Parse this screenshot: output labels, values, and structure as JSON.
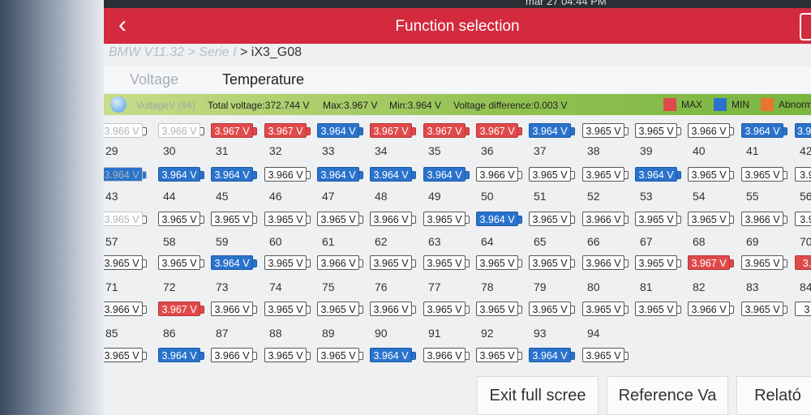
{
  "status_bar": {
    "time": "mar 27 04:44 PM"
  },
  "header": {
    "title": "Function selection",
    "back_glyph": "‹"
  },
  "breadcrumb": {
    "prefix": "BMW V11.32 > Serie I",
    "current": " > iX3_G08"
  },
  "tabs": [
    {
      "label": "Voltage"
    },
    {
      "label": "Temperature"
    }
  ],
  "summary": {
    "voltage_label": "VoltageV (94)",
    "total_voltage": "Total voltage:372.744 V",
    "max": "Max:3.967 V",
    "min": "Min:3.964 V",
    "voltage_difference": "Voltage difference:0.003 V"
  },
  "legend": [
    {
      "label": "MAX",
      "color": "#e04a4a"
    },
    {
      "label": "MIN",
      "color": "#2a73cc"
    },
    {
      "label": "Abnorm",
      "color": "#e8762e"
    }
  ],
  "cells": [
    {
      "n": "",
      "v": "3.966 V",
      "s": "normal"
    },
    {
      "n": "",
      "v": "3.966 V",
      "s": "normal"
    },
    {
      "n": "",
      "v": "3.967 V",
      "s": "max"
    },
    {
      "n": "",
      "v": "3.967 V",
      "s": "max"
    },
    {
      "n": "",
      "v": "3.964 V",
      "s": "min"
    },
    {
      "n": "",
      "v": "3.967 V",
      "s": "max"
    },
    {
      "n": "",
      "v": "3.967 V",
      "s": "max"
    },
    {
      "n": "",
      "v": "3.967 V",
      "s": "max"
    },
    {
      "n": "",
      "v": "3.964 V",
      "s": "min"
    },
    {
      "n": "",
      "v": "3.965 V",
      "s": "normal"
    },
    {
      "n": "",
      "v": "3.965 V",
      "s": "normal"
    },
    {
      "n": "",
      "v": "3.966 V",
      "s": "normal"
    },
    {
      "n": "",
      "v": "3.964 V",
      "s": "min"
    },
    {
      "n": "",
      "v": "3.96",
      "s": "min"
    },
    {
      "n": "29",
      "v": "3.964 V",
      "s": "min"
    },
    {
      "n": "30",
      "v": "3.964 V",
      "s": "min"
    },
    {
      "n": "31",
      "v": "3.964 V",
      "s": "min"
    },
    {
      "n": "32",
      "v": "3.966 V",
      "s": "normal"
    },
    {
      "n": "33",
      "v": "3.964 V",
      "s": "min"
    },
    {
      "n": "34",
      "v": "3.964 V",
      "s": "min"
    },
    {
      "n": "35",
      "v": "3.964 V",
      "s": "min"
    },
    {
      "n": "36",
      "v": "3.966 V",
      "s": "normal"
    },
    {
      "n": "37",
      "v": "3.965 V",
      "s": "normal"
    },
    {
      "n": "38",
      "v": "3.965 V",
      "s": "normal"
    },
    {
      "n": "39",
      "v": "3.964 V",
      "s": "min"
    },
    {
      "n": "40",
      "v": "3.965 V",
      "s": "normal"
    },
    {
      "n": "41",
      "v": "3.965 V",
      "s": "normal"
    },
    {
      "n": "42",
      "v": "3.9",
      "s": "normal"
    },
    {
      "n": "43",
      "v": "3.965 V",
      "s": "normal"
    },
    {
      "n": "44",
      "v": "3.965 V",
      "s": "normal"
    },
    {
      "n": "45",
      "v": "3.965 V",
      "s": "normal"
    },
    {
      "n": "46",
      "v": "3.965 V",
      "s": "normal"
    },
    {
      "n": "47",
      "v": "3.965 V",
      "s": "normal"
    },
    {
      "n": "48",
      "v": "3.966 V",
      "s": "normal"
    },
    {
      "n": "49",
      "v": "3.965 V",
      "s": "normal"
    },
    {
      "n": "50",
      "v": "3.964 V",
      "s": "min"
    },
    {
      "n": "51",
      "v": "3.965 V",
      "s": "normal"
    },
    {
      "n": "52",
      "v": "3.966 V",
      "s": "normal"
    },
    {
      "n": "53",
      "v": "3.965 V",
      "s": "normal"
    },
    {
      "n": "54",
      "v": "3.965 V",
      "s": "normal"
    },
    {
      "n": "55",
      "v": "3.966 V",
      "s": "normal"
    },
    {
      "n": "56",
      "v": "3.9",
      "s": "normal"
    },
    {
      "n": "57",
      "v": "3.965 V",
      "s": "normal"
    },
    {
      "n": "58",
      "v": "3.965 V",
      "s": "normal"
    },
    {
      "n": "59",
      "v": "3.964 V",
      "s": "min"
    },
    {
      "n": "60",
      "v": "3.965 V",
      "s": "normal"
    },
    {
      "n": "61",
      "v": "3.966 V",
      "s": "normal"
    },
    {
      "n": "62",
      "v": "3.965 V",
      "s": "normal"
    },
    {
      "n": "63",
      "v": "3.965 V",
      "s": "normal"
    },
    {
      "n": "64",
      "v": "3.965 V",
      "s": "normal"
    },
    {
      "n": "65",
      "v": "3.965 V",
      "s": "normal"
    },
    {
      "n": "66",
      "v": "3.966 V",
      "s": "normal"
    },
    {
      "n": "67",
      "v": "3.965 V",
      "s": "normal"
    },
    {
      "n": "68",
      "v": "3.967 V",
      "s": "max"
    },
    {
      "n": "69",
      "v": "3.965 V",
      "s": "normal"
    },
    {
      "n": "70",
      "v": "3.",
      "s": "max"
    },
    {
      "n": "71",
      "v": "3.966 V",
      "s": "normal"
    },
    {
      "n": "72",
      "v": "3.967 V",
      "s": "max"
    },
    {
      "n": "73",
      "v": "3.966 V",
      "s": "normal"
    },
    {
      "n": "74",
      "v": "3.965 V",
      "s": "normal"
    },
    {
      "n": "75",
      "v": "3.965 V",
      "s": "normal"
    },
    {
      "n": "76",
      "v": "3.966 V",
      "s": "normal"
    },
    {
      "n": "77",
      "v": "3.965 V",
      "s": "normal"
    },
    {
      "n": "78",
      "v": "3.965 V",
      "s": "normal"
    },
    {
      "n": "79",
      "v": "3.965 V",
      "s": "normal"
    },
    {
      "n": "80",
      "v": "3.965 V",
      "s": "normal"
    },
    {
      "n": "81",
      "v": "3.965 V",
      "s": "normal"
    },
    {
      "n": "82",
      "v": "3.966 V",
      "s": "normal"
    },
    {
      "n": "83",
      "v": "3.965 V",
      "s": "normal"
    },
    {
      "n": "84",
      "v": "3",
      "s": "normal"
    },
    {
      "n": "85",
      "v": "3.965 V",
      "s": "normal"
    },
    {
      "n": "86",
      "v": "3.964 V",
      "s": "min"
    },
    {
      "n": "87",
      "v": "3.966 V",
      "s": "normal"
    },
    {
      "n": "88",
      "v": "3.965 V",
      "s": "normal"
    },
    {
      "n": "89",
      "v": "3.965 V",
      "s": "normal"
    },
    {
      "n": "90",
      "v": "3.964 V",
      "s": "min"
    },
    {
      "n": "91",
      "v": "3.966 V",
      "s": "normal"
    },
    {
      "n": "92",
      "v": "3.965 V",
      "s": "normal"
    },
    {
      "n": "93",
      "v": "3.964 V",
      "s": "min"
    },
    {
      "n": "94",
      "v": "3.965 V",
      "s": "normal"
    }
  ],
  "buttons": {
    "exit_full_screen": "Exit full scree",
    "reference_value": "Reference Va",
    "report": "Relató"
  }
}
